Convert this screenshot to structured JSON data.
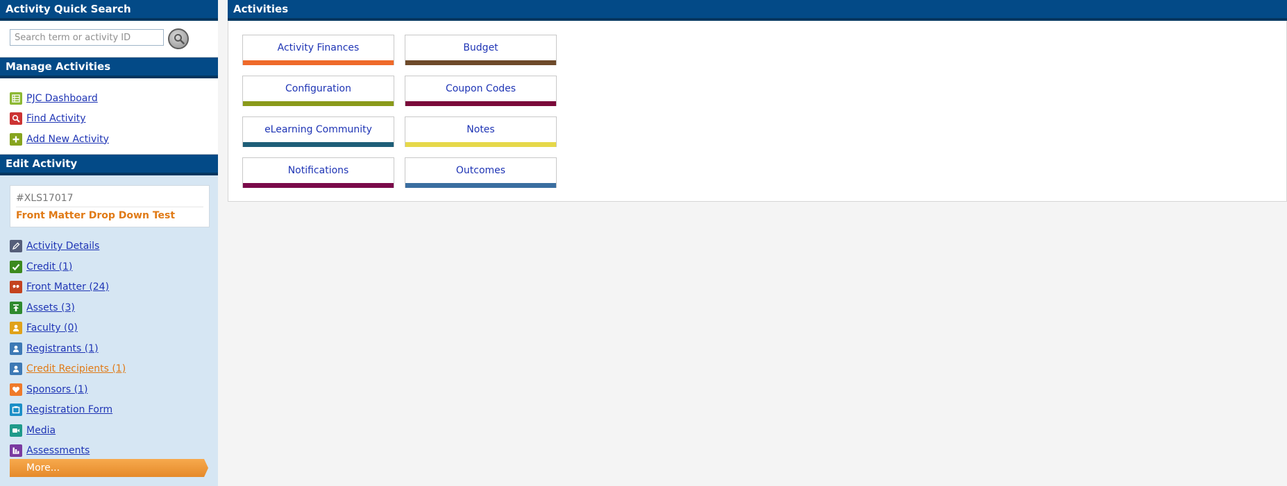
{
  "sidebar": {
    "quick_search": {
      "title": "Activity Quick Search",
      "placeholder": "Search term or activity ID",
      "button_icon": "magnifier-icon"
    },
    "manage": {
      "title": "Manage Activities",
      "items": [
        {
          "label": "PJC Dashboard",
          "icon": "table-icon",
          "color": "#8cb832"
        },
        {
          "label": "Find Activity",
          "icon": "magnifier-icon",
          "color": "#cc3333"
        },
        {
          "label": "Add New Activity",
          "icon": "plus-icon",
          "color": "#86a41e"
        }
      ]
    },
    "edit": {
      "title": "Edit Activity",
      "activity_id": "#XLS17017",
      "activity_title": "Front Matter Drop Down Test",
      "items": [
        {
          "label": "Activity Details",
          "icon": "pencil-icon",
          "color": "#555e7a"
        },
        {
          "label": "Credit (1)",
          "icon": "checkmark-icon",
          "color": "#3c8a1e"
        },
        {
          "label": "Front Matter (24)",
          "icon": "quote-icon",
          "color": "#c4431f"
        },
        {
          "label": "Assets (3)",
          "icon": "upload-icon",
          "color": "#2f8a2f"
        },
        {
          "label": "Faculty (0)",
          "icon": "person-icon",
          "color": "#e0a21b"
        },
        {
          "label": "Registrants (1)",
          "icon": "person-icon",
          "color": "#3d79b5"
        },
        {
          "label": "Credit Recipients (1)",
          "icon": "person-icon",
          "color": "#3d79b5"
        },
        {
          "label": "Sponsors (1)",
          "icon": "heart-icon",
          "color": "#ef7a2a"
        },
        {
          "label": "Registration Form",
          "icon": "form-icon",
          "color": "#1c8fc7"
        },
        {
          "label": "Media",
          "icon": "video-icon",
          "color": "#1f9a8a"
        },
        {
          "label": "Assessments",
          "icon": "chart-icon",
          "color": "#7a3aa0"
        }
      ],
      "more_label": "More..."
    }
  },
  "main": {
    "title": "Activities",
    "tiles": [
      {
        "label": "Activity Finances",
        "color": "#ef6a2a"
      },
      {
        "label": "Budget",
        "color": "#6e4a2a"
      },
      {
        "label": "Configuration",
        "color": "#8a9a1a"
      },
      {
        "label": "Coupon Codes",
        "color": "#7a0a3a"
      },
      {
        "label": "eLearning Community",
        "color": "#1e5e78"
      },
      {
        "label": "Notes",
        "color": "#e6d84a"
      },
      {
        "label": "Notifications",
        "color": "#7a0a4a"
      },
      {
        "label": "Outcomes",
        "color": "#3a6ea0"
      }
    ]
  }
}
